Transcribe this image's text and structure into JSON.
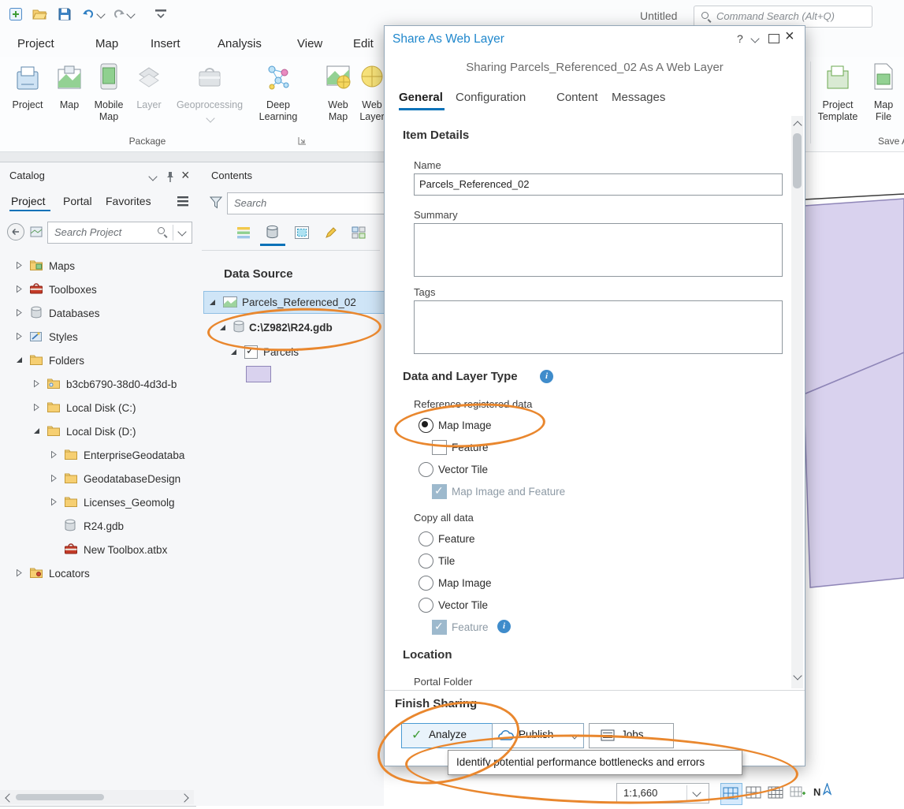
{
  "titlebar": {
    "document": "Untitled",
    "command_search_placeholder": "Command Search (Alt+Q)"
  },
  "menu": {
    "tabs": [
      "Project",
      "Map",
      "Insert",
      "Analysis",
      "View",
      "Edit"
    ]
  },
  "ribbon": {
    "buttons": [
      "Project",
      "Map",
      "Mobile Map",
      "Layer",
      "Geoprocessing",
      "Deep Learning",
      "Web Map",
      "Web Layer"
    ],
    "group_label": "Package",
    "right_buttons": [
      "Project Template",
      "Map File"
    ],
    "right_group_label": "Save A"
  },
  "catalog": {
    "title": "Catalog",
    "tabs": [
      "Project",
      "Portal",
      "Favorites"
    ],
    "search_placeholder": "Search Project",
    "tree": [
      {
        "label": "Maps"
      },
      {
        "label": "Toolboxes"
      },
      {
        "label": "Databases"
      },
      {
        "label": "Styles"
      },
      {
        "label": "Folders"
      },
      {
        "label": "b3cb6790-38d0-4d3d-b"
      },
      {
        "label": "Local Disk (C:)"
      },
      {
        "label": "Local Disk (D:)"
      },
      {
        "label": "EnterpriseGeodataba"
      },
      {
        "label": "GeodatabaseDesign"
      },
      {
        "label": "Licenses_Geomolg"
      },
      {
        "label": "R24.gdb"
      },
      {
        "label": "New Toolbox.atbx"
      },
      {
        "label": "Locators"
      }
    ]
  },
  "contents": {
    "title": "Contents",
    "search_placeholder": "Search",
    "section": "Data Source",
    "tree": {
      "layer": "Parcels_Referenced_02",
      "gdb": "C:\\Z982\\R24.gdb",
      "feature": "Parcels"
    }
  },
  "dialog": {
    "title": "Share As Web Layer",
    "subtitle": "Sharing Parcels_Referenced_02 As A Web Layer",
    "tabs": [
      "General",
      "Configuration",
      "Content",
      "Messages"
    ],
    "item_details": {
      "heading": "Item Details",
      "name_label": "Name",
      "name_value": "Parcels_Referenced_02",
      "summary_label": "Summary",
      "tags_label": "Tags"
    },
    "data_layer": {
      "heading": "Data and Layer Type",
      "reference_label": "Reference registered data",
      "ref_options": [
        "Map Image",
        "Feature",
        "Vector Tile",
        "Map Image and Feature"
      ],
      "copy_label": "Copy all data",
      "copy_options": [
        "Feature",
        "Tile",
        "Map Image",
        "Vector Tile",
        "Feature"
      ]
    },
    "location": {
      "heading": "Location",
      "portal_folder_label": "Portal Folder"
    },
    "finish": {
      "heading": "Finish Sharing",
      "analyze": "Analyze",
      "publish": "Publish",
      "jobs": "Jobs"
    }
  },
  "tooltip": "Identify potential performance bottlenecks and errors",
  "statusbar": {
    "scale": "1:1,660"
  },
  "colors": {
    "accent": "#0a72b8",
    "annotation": "#e9872e",
    "parcel_fill": "#d9d2ee",
    "parcel_stroke": "#8f86b8",
    "selection_bg": "#cfe5f7"
  }
}
